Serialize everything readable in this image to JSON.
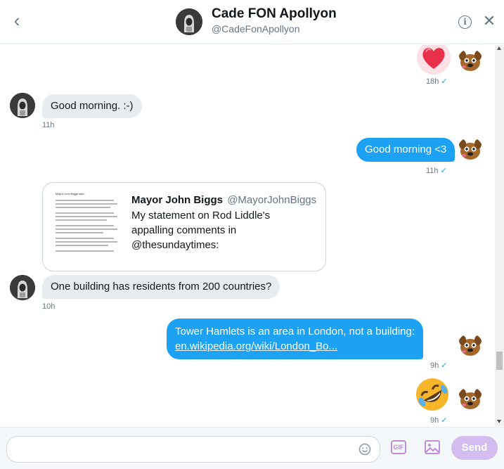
{
  "header": {
    "title": "Cade FON Apollyon",
    "handle": "@CadeFonApollyon",
    "back_icon": "chevron-left-icon",
    "info_icon": "info-icon",
    "info_glyph": "i",
    "close_icon": "close-icon"
  },
  "messages": [
    {
      "id": "m1",
      "sender": "me",
      "type": "emoji",
      "emoji": "heart",
      "time": "18h",
      "read": true
    },
    {
      "id": "m2",
      "sender": "them",
      "type": "text",
      "text": "Good morning. :-)",
      "time": "11h"
    },
    {
      "id": "m3",
      "sender": "me",
      "type": "text",
      "text": "Good morning <3",
      "time": "11h",
      "read": true
    },
    {
      "id": "m4",
      "sender": "them",
      "type": "tweet-card",
      "time": "10h",
      "card": {
        "author_name": "Mayor John Biggs",
        "author_handle": "@MayorJohnBiggs",
        "text": "My statement on Rod Liddle's appalling comments in @thesundaytimes:",
        "thumb_title": "Mayor John Biggs said:"
      },
      "text": "One building has residents from 200 countries?"
    },
    {
      "id": "m5",
      "sender": "me",
      "type": "text-link",
      "text": "Tower Hamlets is an area in London, not a building:",
      "link": "en.wikipedia.org/wiki/London_Bo...",
      "time": "9h",
      "read": true
    },
    {
      "id": "m6",
      "sender": "me",
      "type": "emoji",
      "emoji": "rolling-on-floor-laughing",
      "time": "9h",
      "read": true
    }
  ],
  "read_glyph": "✓",
  "composer": {
    "placeholder": "",
    "value": "",
    "gif_label": "GIF",
    "send_label": "Send",
    "emoji_icon": "smile-icon",
    "image_icon": "image-icon"
  },
  "colors": {
    "accent": "#1da1f2",
    "incoming_bubble": "#e6ecf0",
    "send_disabled": "#d3bdf0",
    "gif_purple": "#bd8fd8"
  }
}
